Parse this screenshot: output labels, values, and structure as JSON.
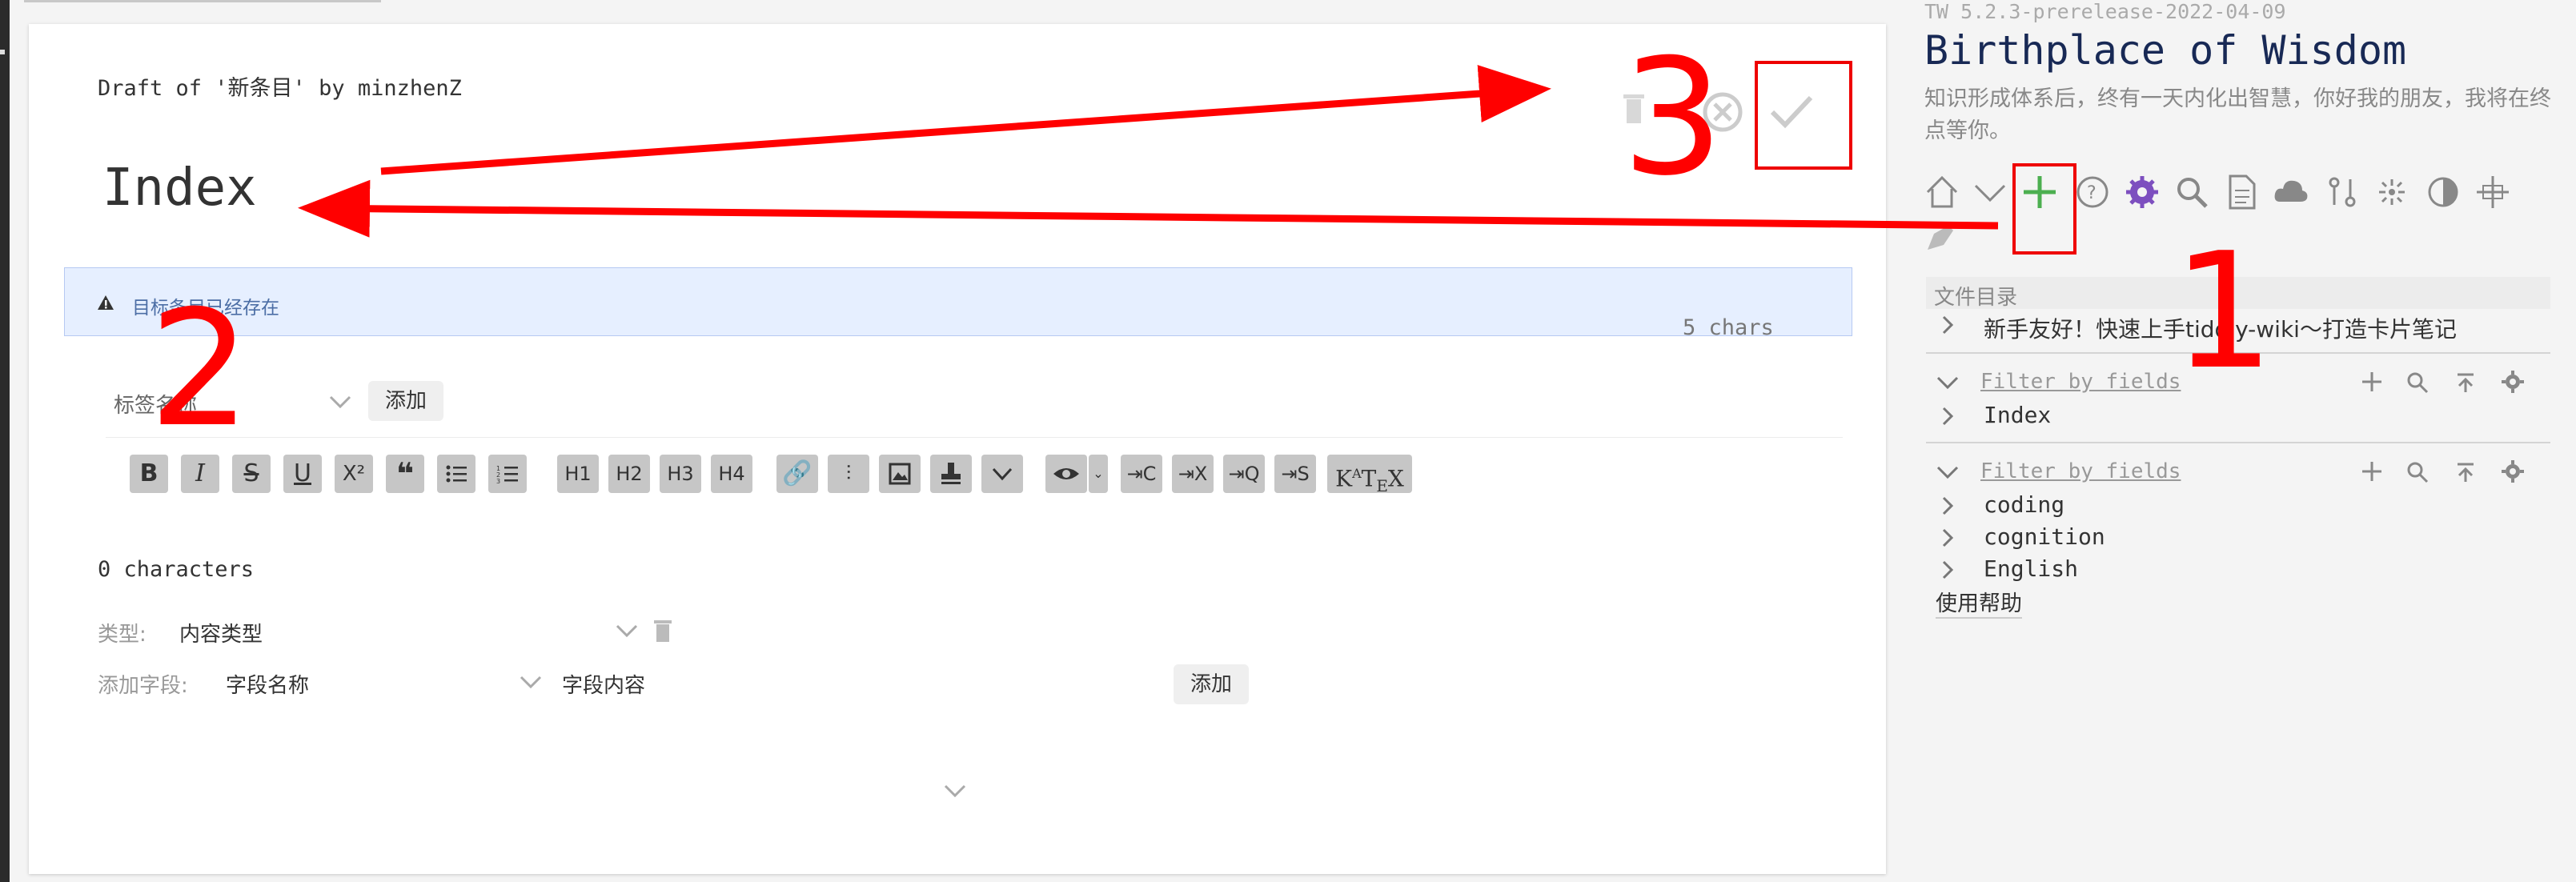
{
  "editor": {
    "draft_title": "Draft of '新条目' by minzhenZ",
    "title_value": "Index",
    "warning": "目标条目已经存在",
    "char_count_title": "5 chars",
    "tag_placeholder": "标签名称",
    "tag_add_label": "添加",
    "toolbar": [
      "B",
      "I",
      "S",
      "U",
      "X²",
      "❝",
      "bullets",
      "numbers",
      "H1",
      "H2",
      "H3",
      "H4",
      "link",
      "transclude",
      "image",
      "stamp",
      "more",
      "preview",
      "preview-type",
      "+C",
      "+X",
      "+Q",
      "+S",
      "KaTeX"
    ],
    "body_char_count": "0 characters",
    "type_label": "类型:",
    "type_value": "内容类型",
    "field_label": "添加字段:",
    "field_name_placeholder": "字段名称",
    "field_value_placeholder": "字段内容",
    "field_add_label": "添加"
  },
  "sidebar": {
    "version": "TW 5.2.3-prerelease-2022-04-09",
    "site_title": "Birthplace of Wisdom",
    "site_subtitle": "知识形成体系后，终有一天内化出智慧，你好我的朋友，我将在终点等你。",
    "toc_heading": "文件目录",
    "toc_items": [
      "新手友好！快速上手tiddly-wiki～打造卡片笔记"
    ],
    "filter1_label": "Filter by fields",
    "filter1_items": [
      "Index"
    ],
    "filter2_label": "Filter by fields",
    "filter2_items": [
      "coding",
      "cognition",
      "English"
    ],
    "help_link": "使用帮助"
  },
  "annotations": {
    "step1": "1",
    "step2": "2",
    "step3": "3",
    "color": "#ff0000"
  }
}
